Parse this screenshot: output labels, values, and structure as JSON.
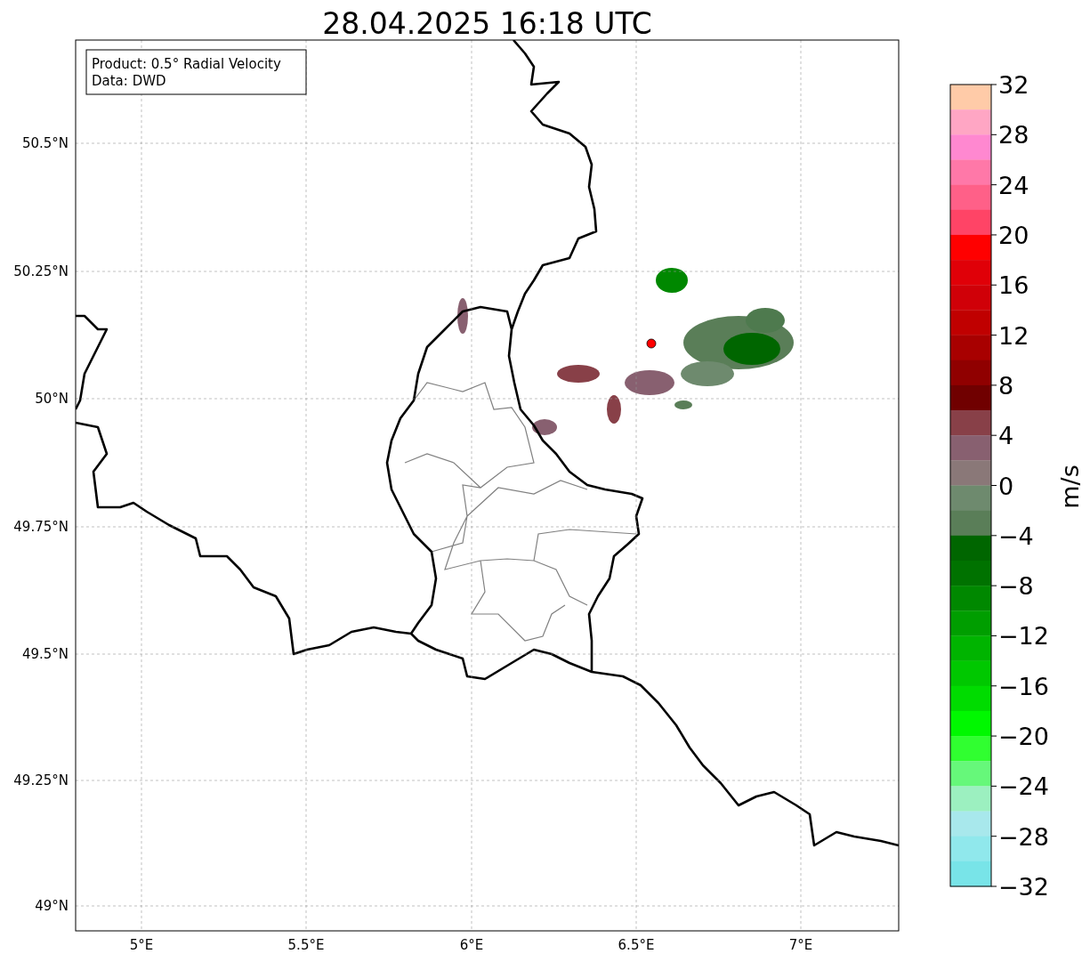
{
  "title": "28.04.2025 16:18 UTC",
  "legend": [
    "Product: 0.5° Radial Velocity",
    "Data: DWD"
  ],
  "map": {
    "lat_ticks": [
      "50.5°N",
      "50.25°N",
      "50°N",
      "49.75°N",
      "49.5°N",
      "49.25°N",
      "49°N"
    ],
    "lon_ticks": [
      "5°E",
      "5.5°E",
      "6°E",
      "6.5°E",
      "7°E"
    ]
  },
  "colorbar": {
    "label": "m/s",
    "ticks": [
      "32",
      "28",
      "24",
      "20",
      "16",
      "12",
      "8",
      "4",
      "0",
      "−4",
      "−8",
      "−12",
      "−16",
      "−20",
      "−24",
      "−28",
      "−32"
    ],
    "bins": [
      {
        "color": "#ffcba8"
      },
      {
        "color": "#ffa6c4"
      },
      {
        "color": "#ff88d0"
      },
      {
        "color": "#ff78a8"
      },
      {
        "color": "#ff6088"
      },
      {
        "color": "#ff4466"
      },
      {
        "color": "#ff0000"
      },
      {
        "color": "#e00008"
      },
      {
        "color": "#d00008"
      },
      {
        "color": "#c00000"
      },
      {
        "color": "#a80000"
      },
      {
        "color": "#900000"
      },
      {
        "color": "#700000"
      },
      {
        "color": "#884048"
      },
      {
        "color": "#886070"
      },
      {
        "color": "#8a7878"
      },
      {
        "color": "#6e8a6e"
      },
      {
        "color": "#5a7e58"
      },
      {
        "color": "#006600"
      },
      {
        "color": "#007200"
      },
      {
        "color": "#008800"
      },
      {
        "color": "#009e00"
      },
      {
        "color": "#00b400"
      },
      {
        "color": "#00c800"
      },
      {
        "color": "#00dc00"
      },
      {
        "color": "#00f800"
      },
      {
        "color": "#30ff30"
      },
      {
        "color": "#66f87a"
      },
      {
        "color": "#9cf0c0"
      },
      {
        "color": "#a8e8ec"
      },
      {
        "color": "#90e8ec"
      },
      {
        "color": "#78e4e8"
      }
    ]
  }
}
